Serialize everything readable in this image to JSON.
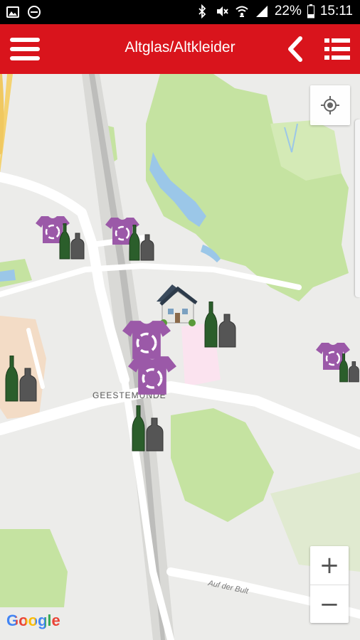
{
  "status_bar": {
    "battery": "22%",
    "time": "15:11"
  },
  "app_bar": {
    "title": "Altglas/Altkleider"
  },
  "map": {
    "labels": {
      "district": "GEESTEMÜNDE",
      "street": "Auf der Bult"
    },
    "attribution": "Google",
    "zoom_in": "+",
    "zoom_out": "−",
    "markers": [
      {
        "type": "clothing-container"
      },
      {
        "type": "glass-container"
      },
      {
        "type": "clothing-container"
      },
      {
        "type": "glass-container"
      },
      {
        "type": "home-location"
      },
      {
        "type": "glass-container"
      },
      {
        "type": "clothing-container"
      },
      {
        "type": "clothing-container"
      },
      {
        "type": "glass-container"
      },
      {
        "type": "glass-container"
      },
      {
        "type": "clothing-container"
      },
      {
        "type": "glass-container"
      }
    ]
  },
  "colors": {
    "app_bar": "#d9141c",
    "clothing_marker": "#9b59a8",
    "park": "#c5e3a1",
    "road": "#ffffff",
    "map_bg": "#ececea"
  }
}
